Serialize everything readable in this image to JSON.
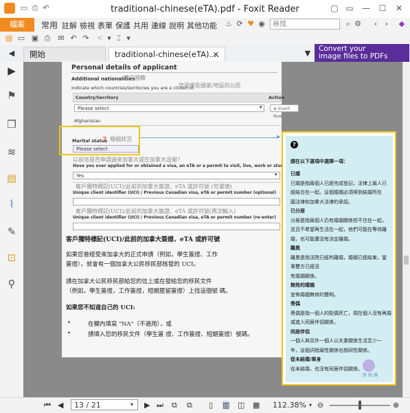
{
  "window": {
    "title": "traditional-chinese(eTA).pdf - Foxit Reader"
  },
  "ribbon": {
    "file_tab": "檔案",
    "menus": [
      "常用",
      "註解",
      "檢視",
      "表單",
      "保護",
      "共用",
      "連線",
      "說明",
      "其他功能"
    ],
    "search_placeholder": "尋找"
  },
  "tabs": {
    "start": "開始",
    "document": "traditional-chinese(eTA)...."
  },
  "ad": {
    "line1": "Convert your",
    "line2": "image files to PDFs"
  },
  "pdf": {
    "section_title": "Personal details of applicant",
    "additional_nationalities": "Additional nationalities",
    "additional_nationalities_cn": "其它國籍",
    "indicate_countries": "Indicate which countries/territories you are a citizen of.",
    "indicate_countries_cn": "您是哪些國家/地區的公民",
    "col_country": "Country/territory",
    "col_action": "Action",
    "please_select": "Please select",
    "insert_row": "Insert Row",
    "afghanistan": "Afghanistan",
    "marital_status": "Marital status",
    "marital_status_cn": "婚姻狀況",
    "marital_please_select": "Please select",
    "applied_cn": "以前您是否申請過來加拿大或在加拿大逗留?",
    "applied_en": "Have you ever applied for or obtained a visa, an eTA or a permit to visit, live, work or study in Canada?",
    "applied_value": "Yes",
    "uci_cn": "客戶獨特標記(UCI)/此前的加拿大簽證、eTA 或許可號 (可選填)",
    "uci_en": "Unique client identifier (UCI) / Previous Canadian visa, eTA or permit number (optional)",
    "uci_reenter_cn": "客戶獨特標記(UCI)/此前的加拿大簽證、eTA 或許可號(再次輸入)",
    "uci_reenter_en": "Unique client identifier (UCI) / Previous Canadian visa, eTA or permit number (re-enter)",
    "uci_heading": "客戶獨特標記(UCI)/此前的加拿大簽證、eTA 或許可號",
    "para1_l1": "如果您曾經受來加拿大的正式申請（例如，學生簽證、工作",
    "para1_l2": "簽證），就會有一個加拿大公民移民部核發的 UCI。",
    "para2_l1": "請在加拿大公民移民部給您的信上或在發給您的移民文件",
    "para2_l2": "（例如，學生簽證，工作簽證，短期居留簽證）上找這個號 碼。",
    "no_uci_heading": "如果您不知道自己的 UCI:",
    "bullet1": "在欄內填寫 \"NA\"（不適用），或",
    "bullet2": "請填入您的移民文件（學生簽 證、工作簽證、短期簽證）號碼。"
  },
  "help_panel": {
    "intro": "請在以下選項中選擇一項：",
    "lines": [
      {
        "t": "已婚",
        "b": true
      },
      {
        "t": "已婚是指兩個人已經完成登記，法律上兩人已",
        "b": false
      },
      {
        "t": "經結合在一起。這個婚姻必須得到結婚所在",
        "b": false
      },
      {
        "t": "國法律和加拿大法律的承認。",
        "b": false
      },
      {
        "t": "已分居",
        "b": true
      },
      {
        "t": "分居是指兩個人仍有婚姻關係但不住在一起，",
        "b": false
      },
      {
        "t": "並且不希望再生活在一起，他們可能在等待離",
        "b": false
      },
      {
        "t": "婚，也可能還沒有決定離婚。",
        "b": false
      },
      {
        "t": "離異",
        "b": true
      },
      {
        "t": "離異是指法院已經判離婚，婚姻已經結束，當",
        "b": false
      },
      {
        "t": "事雙方已經沒",
        "b": false
      },
      {
        "t": "有婚姻關係。",
        "b": false
      },
      {
        "t": "無效的婚姻",
        "b": true
      },
      {
        "t": "宣佈婚姻無效的聲明。",
        "b": false
      },
      {
        "t": "喪偶",
        "b": true
      },
      {
        "t": "喪偶是指一個人的配偶死亡，現在個人沒有再婚",
        "b": false
      },
      {
        "t": "或進入同居伴侶關係。",
        "b": false
      },
      {
        "t": "同居伴侶",
        "b": true
      },
      {
        "t": "一個人與另外一個人以夫妻關係生活至少一",
        "b": false
      },
      {
        "t": "年，這個詞指兩性關係也指同性關係。",
        "b": false
      },
      {
        "t": "從未結婚/單身",
        "b": true
      },
      {
        "t": "從未結婚，也沒有同居伴侶關係。",
        "b": false
      }
    ],
    "watermark": "貴 閱 讀"
  },
  "status": {
    "page": "13 / 21",
    "zoom": "112.38%"
  },
  "colors": {
    "accent": "#f18b20",
    "highlight": "#f0c419",
    "panel_bg": "#d3eef3",
    "ad_bg": "#5a2d9a"
  }
}
